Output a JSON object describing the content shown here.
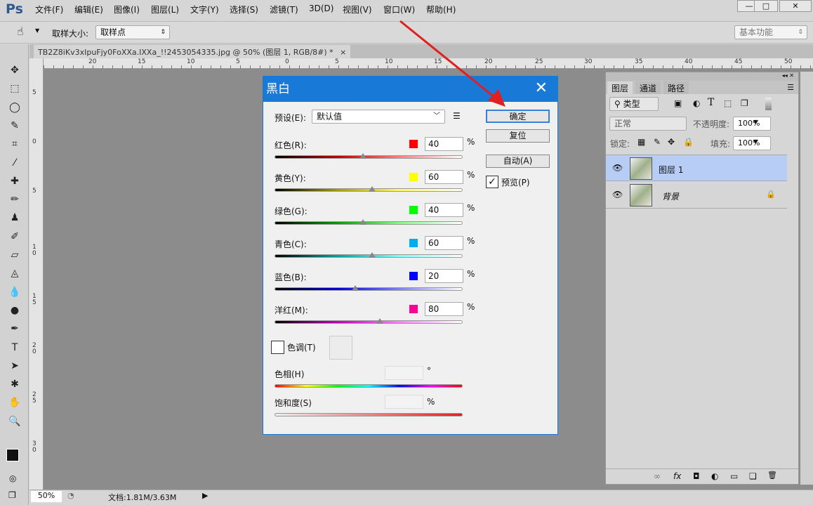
{
  "app": {
    "logo": "Ps",
    "menus": [
      "文件(F)",
      "编辑(E)",
      "图像(I)",
      "图层(L)",
      "文字(Y)",
      "选择(S)",
      "滤镜(T)",
      "3D(D)",
      "视图(V)",
      "窗口(W)",
      "帮助(H)"
    ],
    "window_buttons": [
      "—",
      "□",
      "✕"
    ]
  },
  "options": {
    "sample_size_label": "取样大小:",
    "sample_size_value": "取样点",
    "workspace": "基本功能"
  },
  "document": {
    "tab_title": "TB2Z8iKv3xIpuFjy0FoXXa.IXXa_!!2453054335.jpg @ 50% (图层 1, RGB/8#) *",
    "tab_close": "×",
    "h_ruler": [
      "20",
      "15",
      "10",
      "5",
      "0",
      "5",
      "10",
      "15",
      "20",
      "25",
      "30",
      "35",
      "40",
      "45",
      "50"
    ],
    "v_ruler": [
      "5",
      "0",
      "5",
      "10",
      "15",
      "20",
      "25",
      "30"
    ]
  },
  "status": {
    "zoom": "50%",
    "doc_info": "文档:1.81M/3.63M"
  },
  "dialog": {
    "title": "黑白",
    "close": "✕",
    "preset_label": "预设(E):",
    "preset_value": "默认值",
    "sliders": [
      {
        "label": "红色(R):",
        "value": "40",
        "swatch": "#ff0000",
        "track": "linear-gradient(90deg,#000,#c00000,#ff8080,#fff)",
        "pos": 0.47
      },
      {
        "label": "黄色(Y):",
        "value": "60",
        "swatch": "#ffff00",
        "track": "linear-gradient(90deg,#000,#a0a000,#ffff60,#fff)",
        "pos": 0.52
      },
      {
        "label": "绿色(G):",
        "value": "40",
        "swatch": "#00ff00",
        "track": "linear-gradient(90deg,#000,#00a000,#80ff80,#fff)",
        "pos": 0.47
      },
      {
        "label": "青色(C):",
        "value": "60",
        "swatch": "#00aeef",
        "track": "linear-gradient(90deg,#000,#00a0a0,#80ffff,#fff)",
        "pos": 0.52
      },
      {
        "label": "蓝色(B):",
        "value": "20",
        "swatch": "#0000ff",
        "track": "linear-gradient(90deg,#000,#0000e0,#8080ff,#fff)",
        "pos": 0.43
      },
      {
        "label": "洋红(M):",
        "value": "80",
        "swatch": "#ff0090",
        "track": "linear-gradient(90deg,#000,#c000c0,#ff80ff,#fff)",
        "pos": 0.56
      }
    ],
    "percent": "%",
    "tint_label": "色调(T)",
    "hue_label": "色相(H)",
    "hue_unit": "°",
    "saturation_label": "饱和度(S)",
    "saturation_unit": "%",
    "ok": "确定",
    "reset": "复位",
    "auto": "自动(A)",
    "preview": "预览(P)",
    "preview_checked": true
  },
  "layers_panel": {
    "tabs": [
      "图层",
      "通道",
      "路径"
    ],
    "filter": "类型",
    "blend_mode": "正常",
    "opacity_label": "不透明度:",
    "opacity": "100%",
    "lock_label": "锁定:",
    "fill_label": "填充:",
    "fill": "100%",
    "layers": [
      {
        "name": "图层 1",
        "selected": true
      },
      {
        "name": "背景",
        "locked": true
      }
    ],
    "footer_icons": [
      "∞",
      "fx",
      "◘",
      "◐",
      "▭",
      "❏",
      "🗑"
    ]
  }
}
